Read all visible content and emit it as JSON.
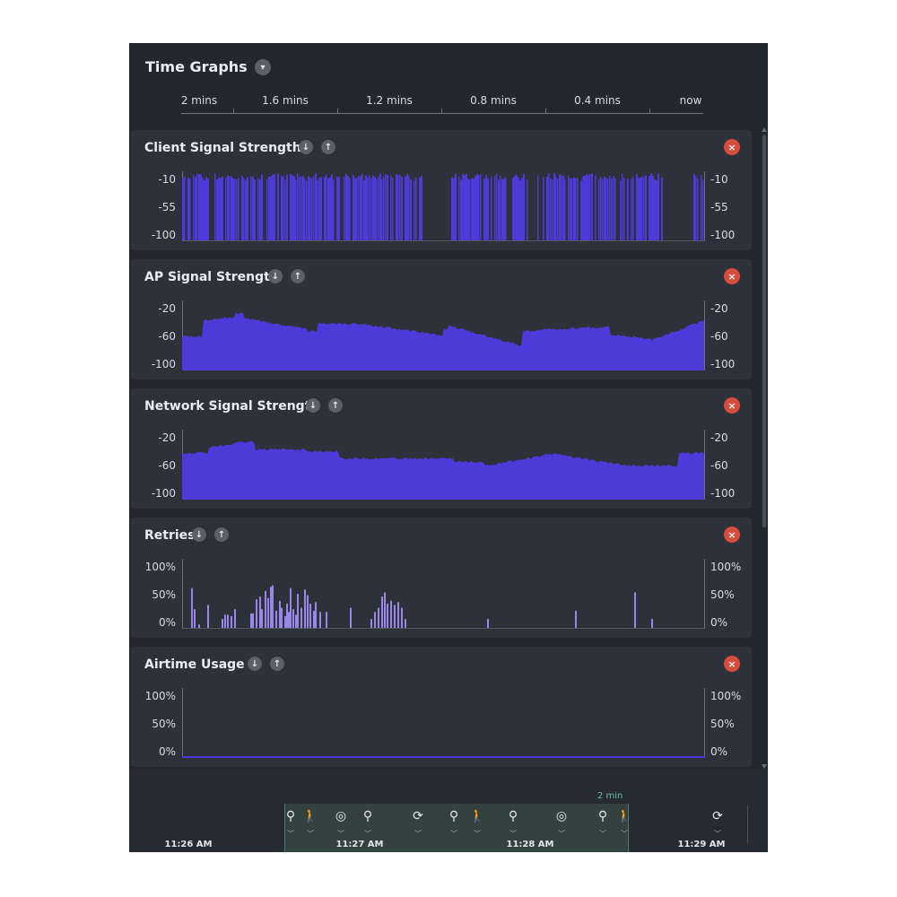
{
  "header": {
    "title": "Time Graphs",
    "collapse_icon": "chevron-down-icon"
  },
  "ruler": {
    "labels": [
      "2 mins",
      "1.6 mins",
      "1.2 mins",
      "0.8 mins",
      "0.4 mins",
      "now"
    ]
  },
  "panels": [
    {
      "title": "Client Signal Strength",
      "kind": "bars",
      "axis_labels": [
        "-10",
        "-55",
        "-100"
      ],
      "ylim": [
        -100,
        -10
      ]
    },
    {
      "title": "AP Signal Strength",
      "kind": "area",
      "axis_labels": [
        "-20",
        "-60",
        "-100"
      ],
      "ylim": [
        -100,
        -20
      ]
    },
    {
      "title": "Network Signal Strength",
      "kind": "area",
      "axis_labels": [
        "-20",
        "-60",
        "-100"
      ],
      "ylim": [
        -100,
        -20
      ]
    },
    {
      "title": "Retries",
      "kind": "spikes",
      "axis_labels": [
        "100%",
        "50%",
        "0%"
      ],
      "ylim": [
        0,
        100
      ]
    },
    {
      "title": "Airtime Usage",
      "kind": "flat",
      "axis_labels": [
        "100%",
        "50%",
        "0%"
      ],
      "ylim": [
        0,
        100
      ]
    }
  ],
  "panel_icons": {
    "down": "arrow-down-icon",
    "up": "arrow-up-icon",
    "close": "close-icon"
  },
  "colors": {
    "signal": "#4b3bd8",
    "retries": "#9a86e8",
    "background": "#23272f",
    "panel": "#2c313a",
    "close": "#d64b3c",
    "window": "#33423f"
  },
  "timeline": {
    "window_label": "2 min",
    "times": [
      "11:26 AM",
      "11:27 AM",
      "11:28 AM",
      "11:29 AM"
    ],
    "event_icons": [
      "search-icon",
      "walking-icon",
      "signal-icon",
      "search-icon",
      "refresh-icon",
      "search-icon",
      "walking-icon",
      "search-icon",
      "signal-icon",
      "search-icon",
      "walking-icon",
      "refresh-icon"
    ]
  }
}
